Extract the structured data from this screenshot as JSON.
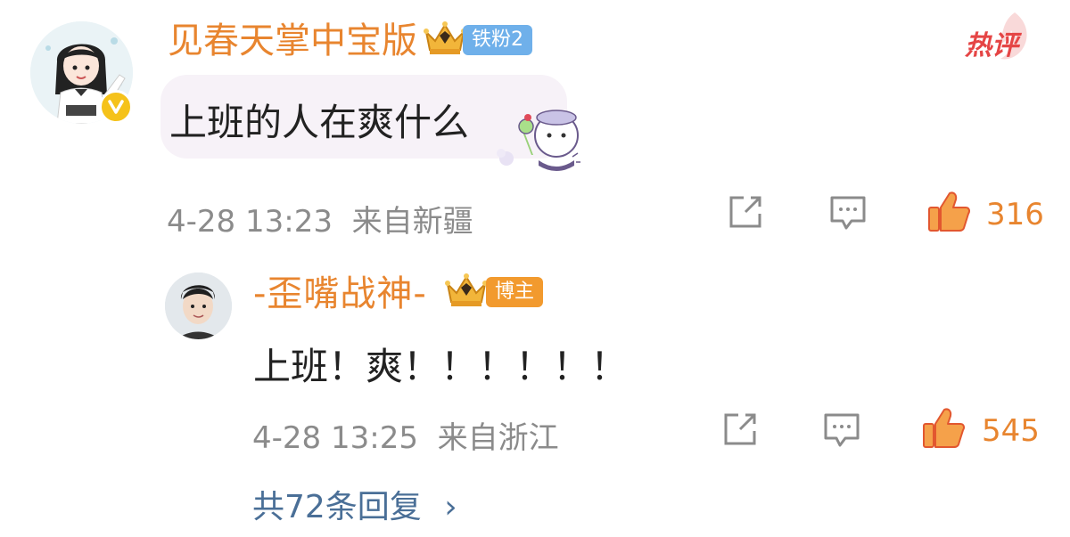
{
  "hot_tag": "热评",
  "comment": {
    "username": "见春天掌中宝版",
    "fan_badge": "铁粉2",
    "text": "上班的人在爽什么",
    "time": "4-28 13:23",
    "location": "来自新疆",
    "likes": "316",
    "avatar_icon": "girl-avatar-icon",
    "verified_icon": "verified-badge-icon"
  },
  "reply": {
    "username": "-歪嘴战神-",
    "role_badge": "博主",
    "text": "上班！爽！！！！！！",
    "time": "4-28 13:25",
    "location": "来自浙江",
    "likes": "545",
    "avatar_icon": "man-avatar-icon"
  },
  "more_replies": {
    "label": "共72条回复",
    "chevron": "›"
  },
  "colors": {
    "username": "#e8852f",
    "meta": "#8b8b8b",
    "link": "#4a6f97",
    "fan_badge": "#6fb0ea",
    "blogger_badge": "#f29a2e",
    "hot": "#e54545"
  }
}
